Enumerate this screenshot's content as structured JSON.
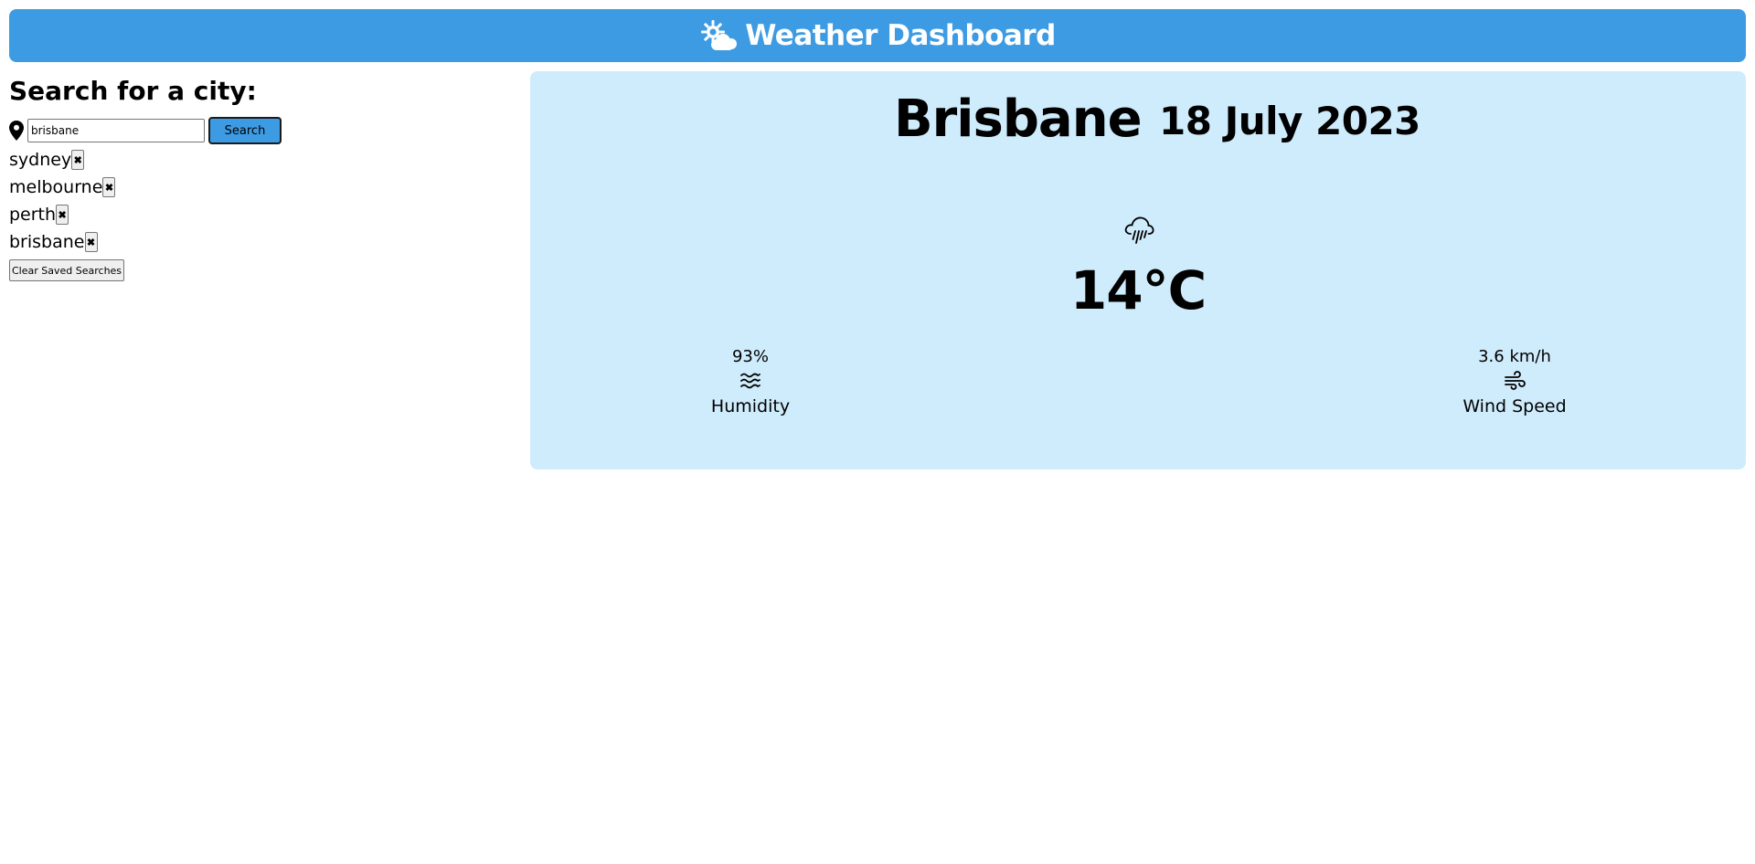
{
  "header": {
    "title": "Weather Dashboard",
    "icon": "sun-cloud-icon"
  },
  "sidebar": {
    "heading": "Search for a city:",
    "search": {
      "value": "brisbane",
      "button_label": "Search"
    },
    "saved": [
      {
        "city": "sydney",
        "remove_glyph": "✖"
      },
      {
        "city": "melbourne",
        "remove_glyph": "✖"
      },
      {
        "city": "perth",
        "remove_glyph": "✖"
      },
      {
        "city": "brisbane",
        "remove_glyph": "✖"
      }
    ],
    "clear_label": "Clear Saved Searches"
  },
  "weather": {
    "city": "Brisbane",
    "date": "18 July 2023",
    "condition_icon": "rain-cloud-icon",
    "temperature": "14°C",
    "humidity": {
      "value": "93%",
      "label": "Humidity",
      "icon": "water-waves-icon"
    },
    "wind": {
      "value": "3.6 km/h",
      "label": "Wind Speed",
      "icon": "wind-icon"
    }
  },
  "colors": {
    "header_bg": "#3d9be3",
    "card_bg": "#cfecfc",
    "button_bg": "#3d9be3"
  }
}
